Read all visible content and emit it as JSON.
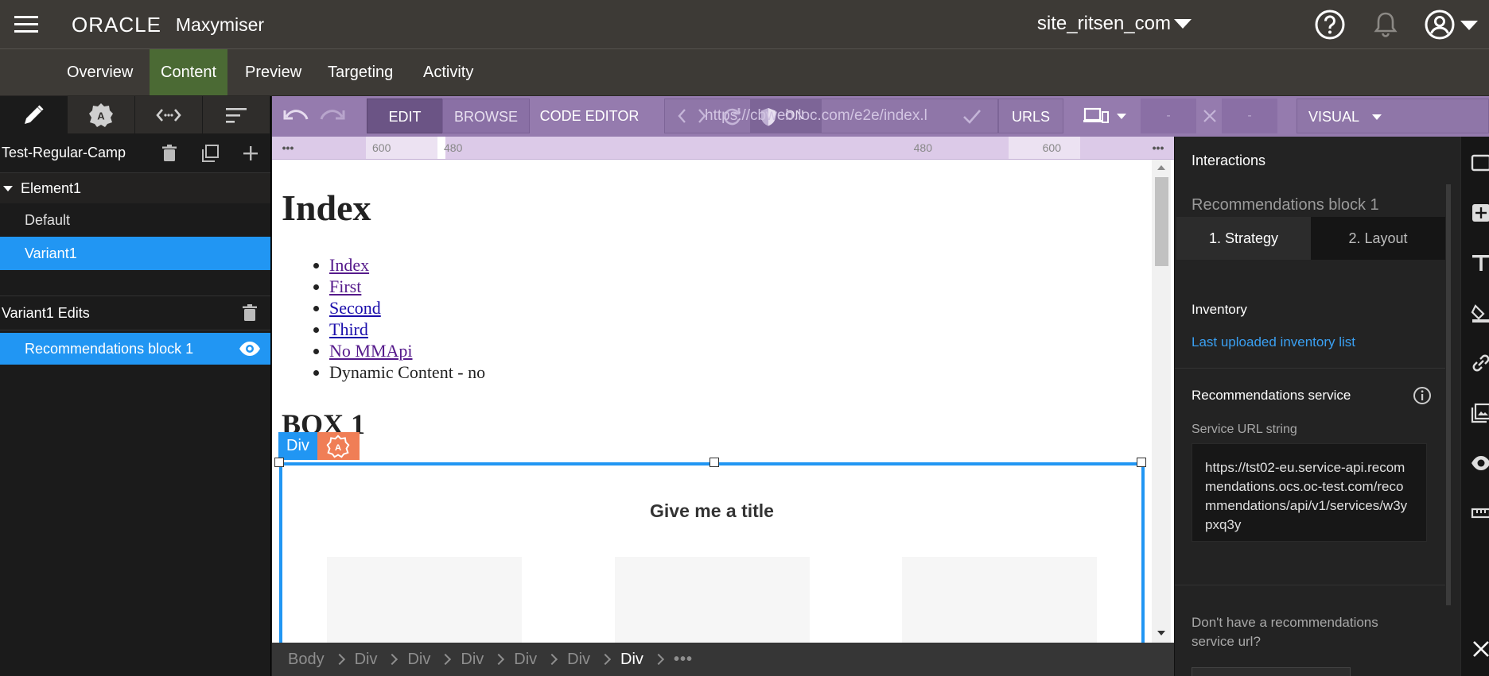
{
  "header": {
    "brand_oracle": "ORACLE",
    "brand_product": "Maxymiser",
    "site": "site_ritsen_com"
  },
  "nav": {
    "items": [
      "Overview",
      "Content",
      "Preview",
      "Targeting",
      "Activity"
    ],
    "active": "Content"
  },
  "left_panel": {
    "campaign": "Test-Regular-Camp",
    "element": "Element1",
    "variants": [
      "Default",
      "Variant1"
    ],
    "selected_variant": "Variant1",
    "edits_header": "Variant1 Edits",
    "edit_item": "Recommendations block 1"
  },
  "toolbar": {
    "edit": "EDIT",
    "browse": "BROWSE",
    "code_editor": "CODE EDITOR",
    "on_label": "ON",
    "url": "https://cbweb.loc.com/e2e/index.l",
    "urls": "URLS",
    "dim1": "-",
    "dim2": "-",
    "visual": "VISUAL"
  },
  "ruler": {
    "left_outer": "600",
    "left_inner": "480",
    "right_inner": "480",
    "right_outer": "600"
  },
  "canvas": {
    "heading": "Index",
    "links": [
      {
        "text": "Index",
        "visited": true
      },
      {
        "text": "First",
        "visited": true
      },
      {
        "text": "Second",
        "visited": false
      },
      {
        "text": "Third",
        "visited": false
      },
      {
        "text": "No MMApi",
        "visited": true
      }
    ],
    "plain_item": "Dynamic Content - no",
    "box_heading": "BOX 1",
    "selection_tag": "Div",
    "rec_title": "Give me a title"
  },
  "breadcrumb": {
    "items": [
      "Body",
      "Div",
      "Div",
      "Div",
      "Div",
      "Div",
      "Div"
    ],
    "active_index": 6
  },
  "right_panel": {
    "title": "Interactions",
    "subtitle": "Recommendations block 1",
    "tab_strategy": "1. Strategy",
    "tab_layout": "2. Layout",
    "inventory_label": "Inventory",
    "inventory_link": "Last uploaded inventory list",
    "service_heading": "Recommendations service",
    "service_url_label": "Service URL string",
    "service_url": "https://tst02-eu.service-api.recommendations.ocs.oc-test.com/recommendations/api/v1/services/w3ypxq3y",
    "no_service": "Don't have a recommendations service url?"
  },
  "colors": {
    "accent_blue": "#2196f3",
    "nav_active": "#4b6a34",
    "toolbar_purple": "#957bae",
    "tag_orange": "#f07e56"
  },
  "icons": {
    "menu": "hamburger-icon",
    "help": "help-icon",
    "notifications": "bell-icon",
    "account": "user-icon"
  }
}
